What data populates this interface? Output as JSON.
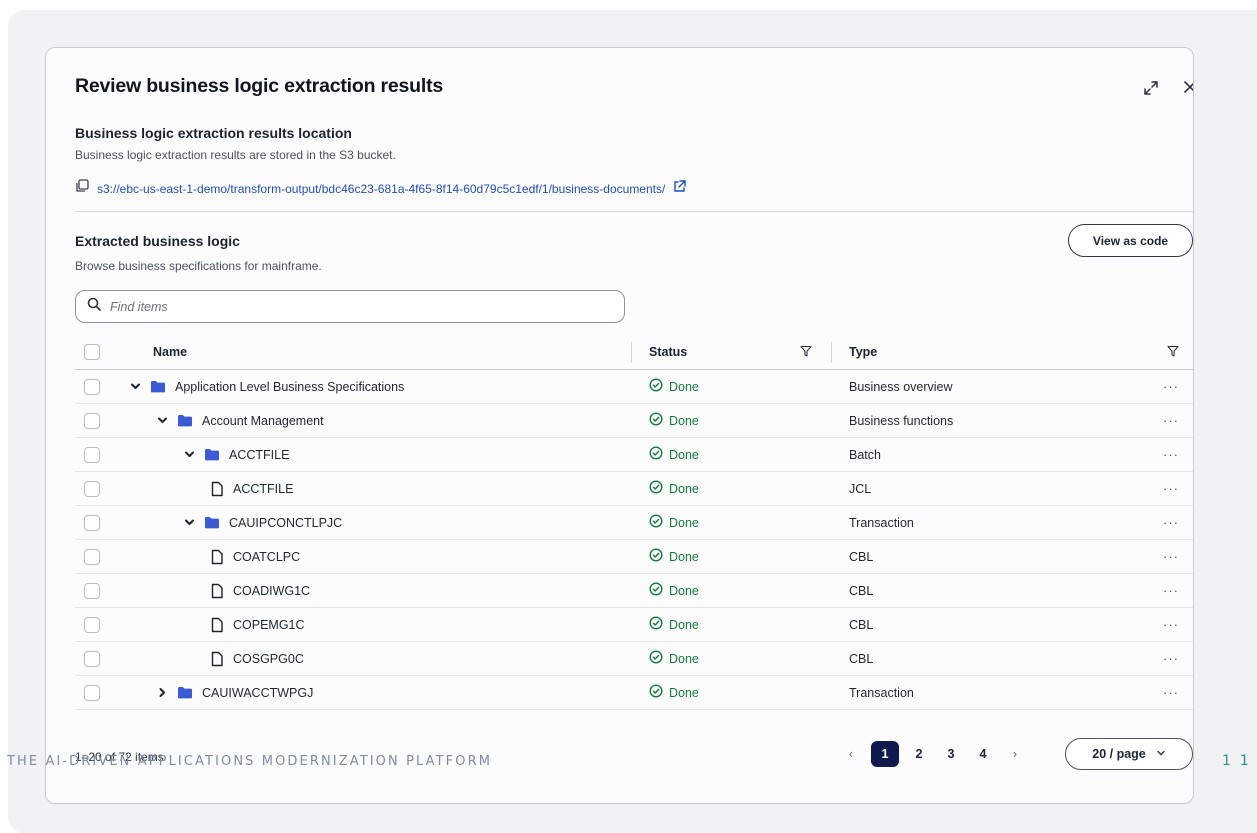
{
  "modal": {
    "title": "Review business logic extraction results"
  },
  "location": {
    "heading": "Business logic extraction results location",
    "description": "Business logic extraction results are stored in the S3 bucket.",
    "s3_uri": "s3://ebc-us-east-1-demo/transform-output/bdc46c23-681a-4f65-8f14-60d79c5c1edf/1/business-documents/"
  },
  "extracted": {
    "heading": "Extracted business logic",
    "description": "Browse business specifications for mainframe.",
    "view_as_code_label": "View as code",
    "search_placeholder": "Find items"
  },
  "table": {
    "columns": {
      "name": "Name",
      "status": "Status",
      "type": "Type"
    },
    "rows": [
      {
        "name": "Application Level Business Specifications",
        "status": "Done",
        "type": "Business overview",
        "kind": "folder",
        "expanded": true,
        "depth": 0
      },
      {
        "name": "Account Management",
        "status": "Done",
        "type": "Business functions",
        "kind": "folder",
        "expanded": true,
        "depth": 1
      },
      {
        "name": "ACCTFILE",
        "status": "Done",
        "type": "Batch",
        "kind": "folder",
        "expanded": true,
        "depth": 2
      },
      {
        "name": "ACCTFILE",
        "status": "Done",
        "type": "JCL",
        "kind": "file",
        "depth": 3
      },
      {
        "name": "CAUIPCONCTLPJC",
        "status": "Done",
        "type": "Transaction",
        "kind": "folder",
        "expanded": true,
        "depth": 2
      },
      {
        "name": "COATCLPC",
        "status": "Done",
        "type": "CBL",
        "kind": "file",
        "depth": 3
      },
      {
        "name": "COADIWG1C",
        "status": "Done",
        "type": "CBL",
        "kind": "file",
        "depth": 3
      },
      {
        "name": "COPEMG1C",
        "status": "Done",
        "type": "CBL",
        "kind": "file",
        "depth": 3
      },
      {
        "name": "COSGPG0C",
        "status": "Done",
        "type": "CBL",
        "kind": "file",
        "depth": 3
      },
      {
        "name": "CAUIWACCTWPGJ",
        "status": "Done",
        "type": "Transaction",
        "kind": "folder",
        "expanded": false,
        "depth": 1
      }
    ],
    "row_actions_label": "···"
  },
  "footer": {
    "range_text": "1–20 of 72 items",
    "pages": [
      "1",
      "2",
      "3",
      "4"
    ],
    "current_page": "1",
    "prev_label": "‹",
    "next_label": "›",
    "page_size_label": "20 / page"
  },
  "overlay": {
    "watermark": "THE AI-DRIVEN APPLICATIONS MODERNIZATION PLATFORM",
    "slide_number": "11"
  },
  "colors": {
    "accent_navy": "#0e1a4d",
    "link_blue": "#1f4ebd",
    "status_green": "#137a3a",
    "folder_blue": "#3b5bd6"
  },
  "icons": [
    "expand-icon",
    "close-icon",
    "copy-icon",
    "external-link-icon",
    "search-icon",
    "filter-icon",
    "chevron-down-icon",
    "chevron-right-icon",
    "folder-icon",
    "file-icon",
    "check-circle-icon",
    "chevron-down-icon"
  ]
}
